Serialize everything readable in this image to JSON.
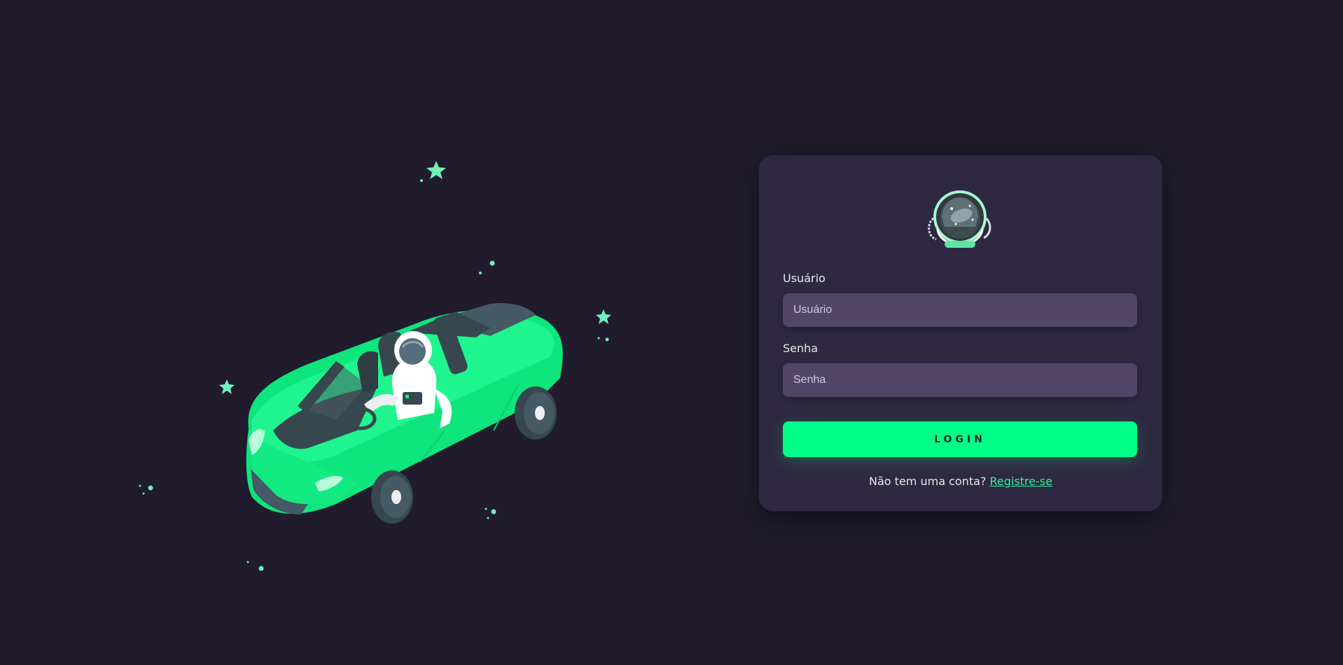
{
  "form": {
    "username_label": "Usuário",
    "username_placeholder": "Usuário",
    "username_value": "",
    "password_label": "Senha",
    "password_placeholder": "Senha",
    "password_value": "",
    "login_label": "LOGIN",
    "register_prompt": "Não tem uma conta?",
    "register_link": "Registre-se"
  },
  "colors": {
    "background": "#201c2d",
    "card": "#2e2940",
    "input": "#514668",
    "accent": "#00ff88"
  },
  "icons": {
    "illustration": "astronaut-driving-green-convertible",
    "avatar": "astronaut-helmet-icon"
  }
}
